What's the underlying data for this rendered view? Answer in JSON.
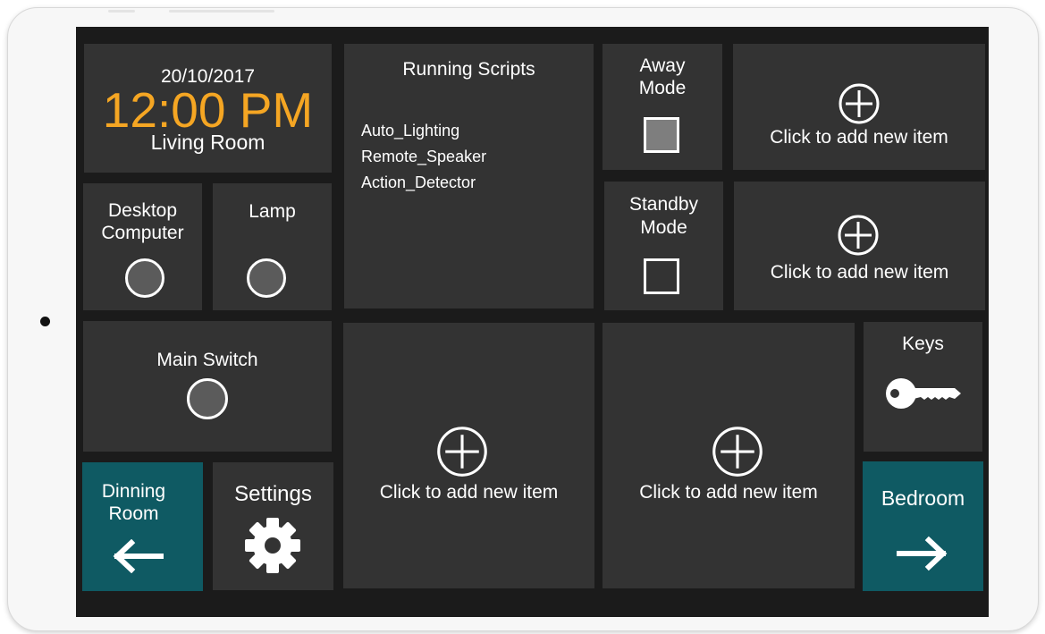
{
  "clock": {
    "date": "20/10/2017",
    "time": "12:00 PM",
    "room": "Living Room",
    "time_color": "#f5a623"
  },
  "devices": {
    "desktop_label_line1": "Desktop",
    "desktop_label_line2": "Computer",
    "lamp_label": "Lamp",
    "main_switch_label": "Main Switch"
  },
  "scripts": {
    "title": "Running Scripts",
    "items": [
      "Auto_Lighting",
      "Remote_Speaker",
      "Action_Detector"
    ]
  },
  "modes": {
    "away_line1": "Away",
    "away_line2": "Mode",
    "standby_line1": "Standby",
    "standby_line2": "Mode"
  },
  "add_item": {
    "label": "Click to add new item"
  },
  "keys": {
    "label": "Keys"
  },
  "nav": {
    "left_line1": "Dinning",
    "left_line2": "Room",
    "settings_label": "Settings",
    "right_label": "Bedroom"
  },
  "colors": {
    "tile": "#333333",
    "screen": "#1b1b1b",
    "teal": "#0f5a63",
    "accent": "#f5a623"
  },
  "icons": [
    "plus-circle-icon",
    "key-icon",
    "gear-icon",
    "arrow-left-icon",
    "arrow-right-icon"
  ]
}
